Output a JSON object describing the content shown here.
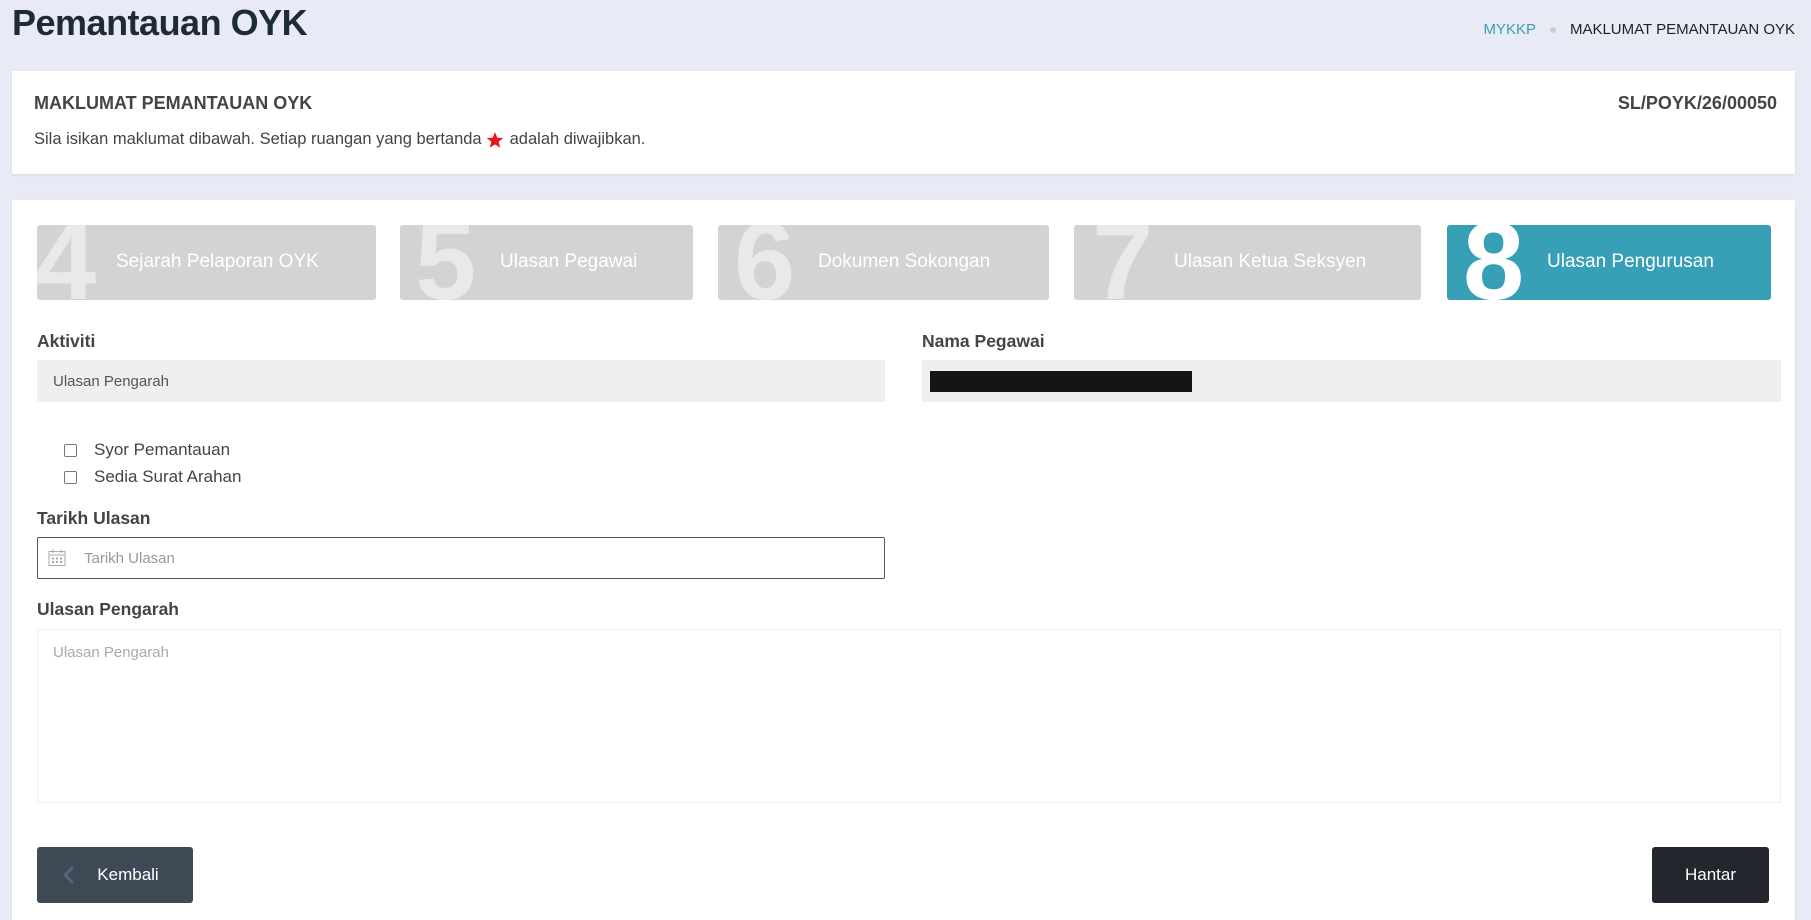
{
  "page": {
    "title": "Pemantauan OYK"
  },
  "breadcrumb": {
    "link": "MYKKP",
    "current": "MAKLUMAT PEMANTAUAN OYK"
  },
  "info_card": {
    "title": "MAKLUMAT PEMANTAUAN OYK",
    "reference_no": "SL/POYK/26/00050",
    "instruction_before": "Sila isikan maklumat dibawah. Setiap ruangan yang bertanda",
    "instruction_after": "adalah diwajibkan."
  },
  "steps": [
    {
      "number": "4",
      "label": "Sejarah Pelaporan OYK",
      "active": false
    },
    {
      "number": "5",
      "label": "Ulasan Pegawai",
      "active": false
    },
    {
      "number": "6",
      "label": "Dokumen Sokongan",
      "active": false
    },
    {
      "number": "7",
      "label": "Ulasan Ketua Seksyen",
      "active": false
    },
    {
      "number": "8",
      "label": "Ulasan Pengurusan",
      "active": true
    }
  ],
  "form": {
    "aktiviti_label": "Aktiviti",
    "aktiviti_value": "Ulasan Pengarah",
    "nama_pegawai_label": "Nama Pegawai",
    "checkboxes": [
      {
        "label": "Syor Pemantauan",
        "checked": false
      },
      {
        "label": "Sedia Surat Arahan",
        "checked": false
      }
    ],
    "tarikh_label": "Tarikh Ulasan",
    "tarikh_placeholder": "Tarikh Ulasan",
    "ulasan_label": "Ulasan Pengarah",
    "ulasan_placeholder": "Ulasan Pengarah"
  },
  "buttons": {
    "back_label": "Kembali",
    "submit_label": "Hantar"
  },
  "colors": {
    "active_step": "#37a0b6",
    "inactive_step": "#d3d3d3",
    "required_star": "#e8141b",
    "back_button": "#3d4a56",
    "submit_button": "#23272d"
  }
}
